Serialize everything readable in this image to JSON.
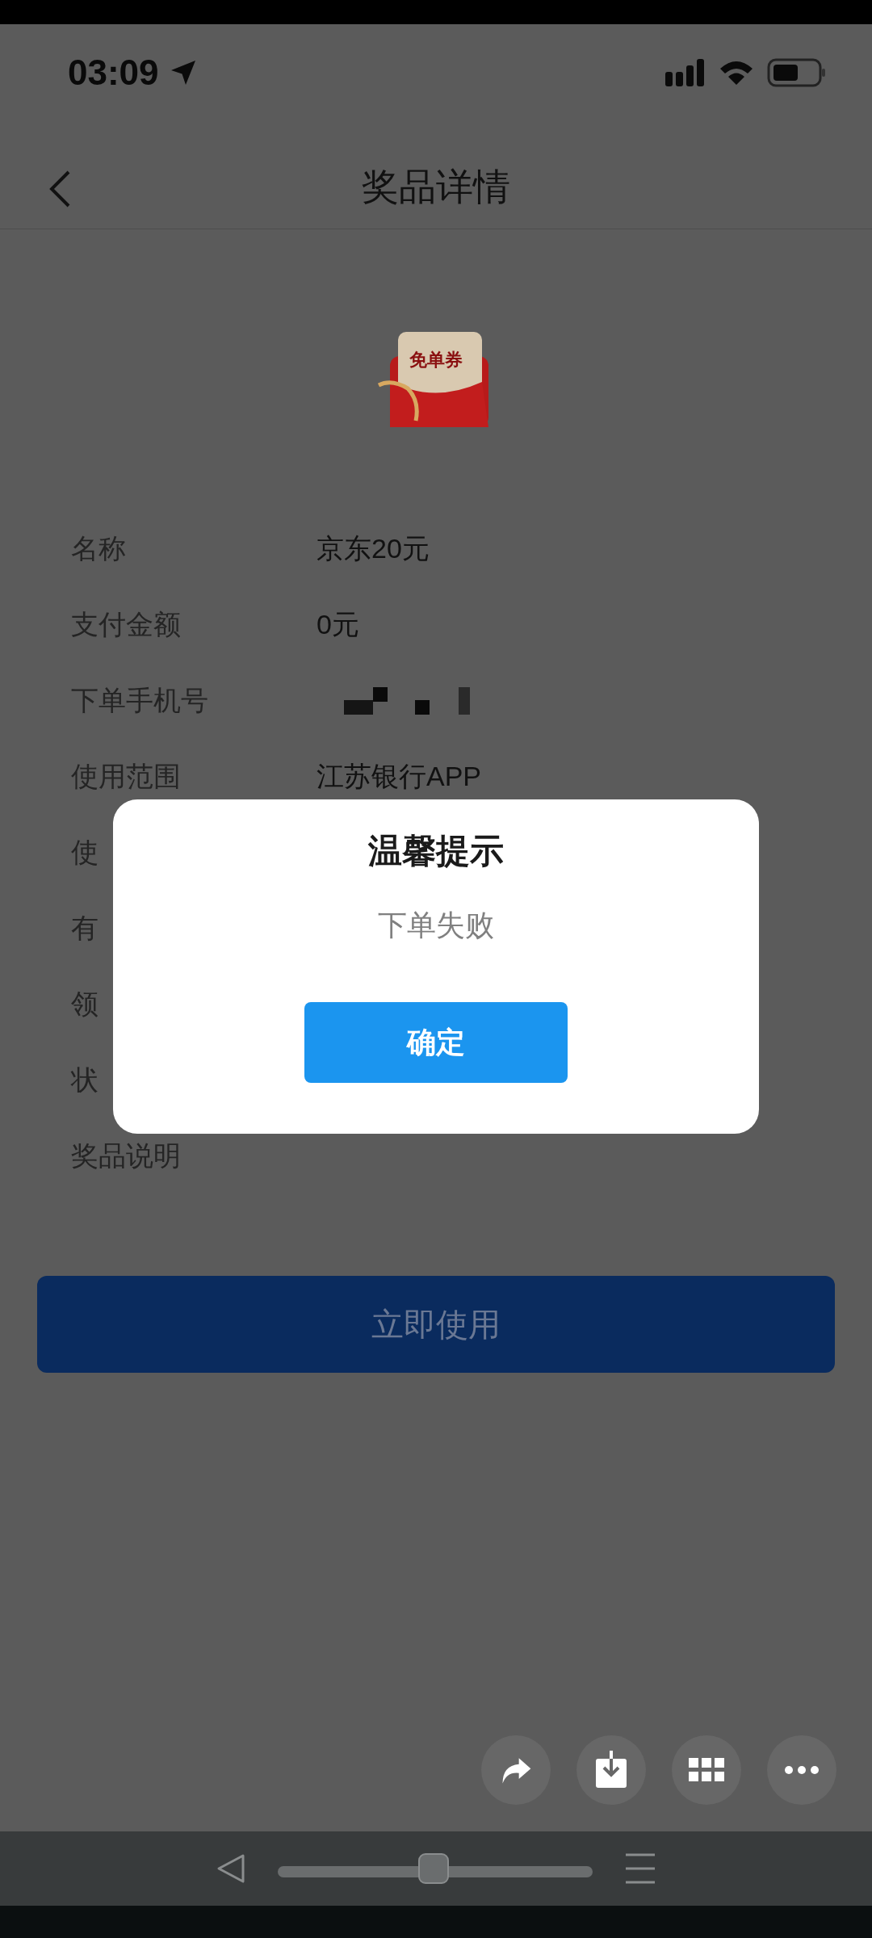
{
  "status_bar": {
    "time": "03:09"
  },
  "header": {
    "title": "奖品详情"
  },
  "prize": {
    "badge": "免单券",
    "rows": [
      {
        "kind": "text",
        "label": "名称",
        "value": "京东20元"
      },
      {
        "kind": "text",
        "label": "支付金额",
        "value": "0元"
      },
      {
        "kind": "redacted",
        "label": "下单手机号"
      },
      {
        "kind": "text",
        "label": "使用范围",
        "value": "江苏银行APP"
      },
      {
        "kind": "text",
        "label": "使"
      },
      {
        "kind": "text",
        "label": "有"
      },
      {
        "kind": "text",
        "label": "领"
      },
      {
        "kind": "text",
        "label": "状"
      },
      {
        "kind": "text",
        "label": "奖品说明"
      }
    ]
  },
  "use_button": "立即使用",
  "dialog": {
    "title": "温馨提示",
    "message": "下单失败",
    "confirm": "确定"
  }
}
